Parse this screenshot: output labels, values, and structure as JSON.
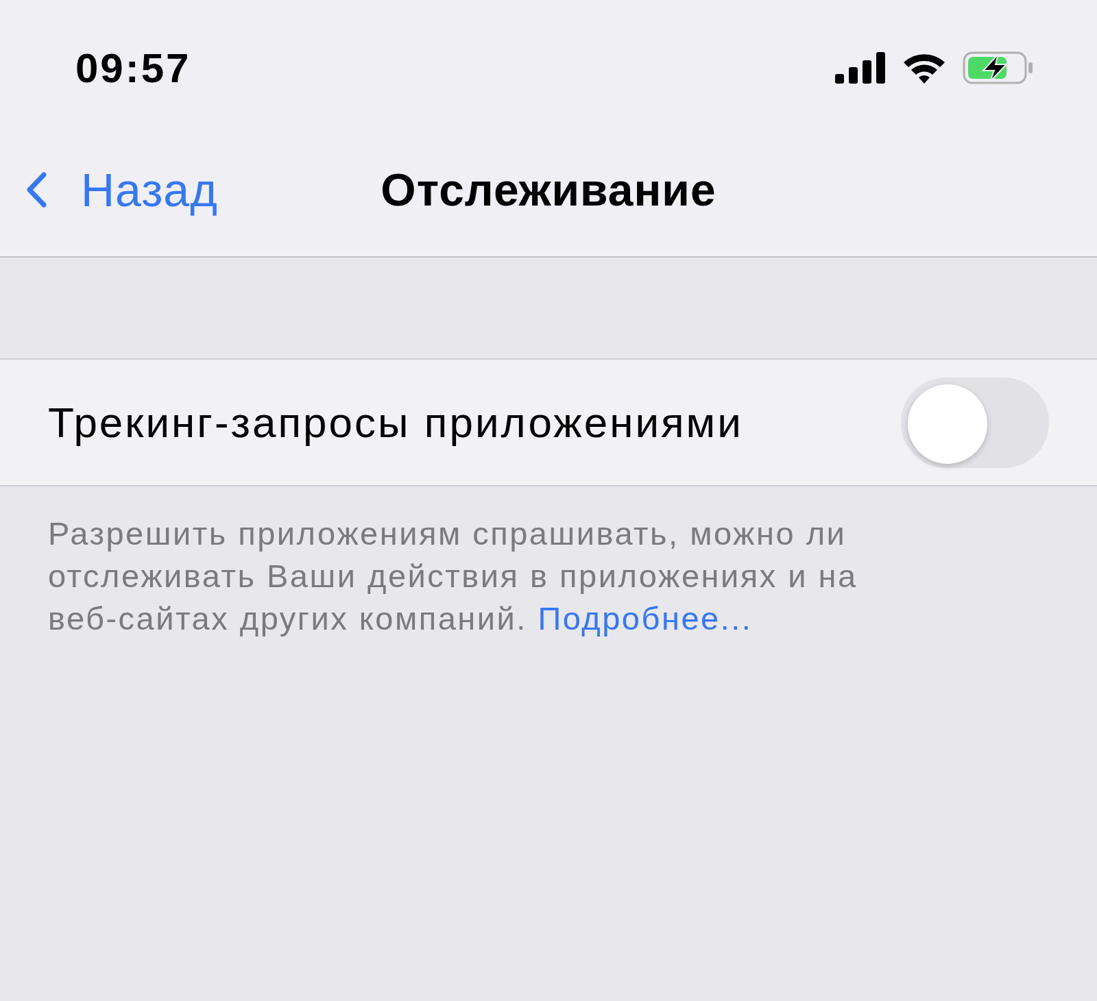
{
  "status_bar": {
    "time": "09:57",
    "battery_charging": true
  },
  "nav": {
    "back": "Назад",
    "title": "Отслеживание"
  },
  "setting": {
    "label": "Трекинг-запросы приложениями",
    "on": false
  },
  "footer": {
    "text": "Разрешить приложениям спрашивать, можно ли отслеживать Ваши действия в приложениях и на веб-сайтах других компаний.",
    "link": "Подробнее..."
  }
}
